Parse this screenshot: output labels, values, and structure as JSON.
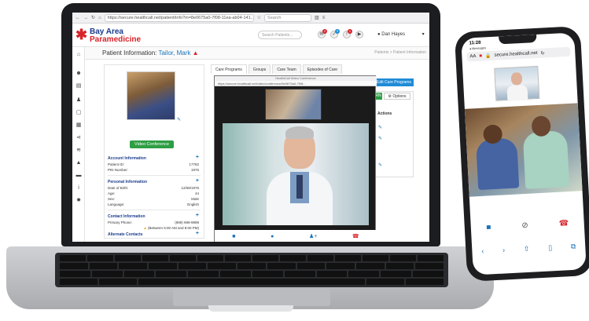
{
  "browser": {
    "url": "https://secure.healthcall.net/patient/info?m=8e0675a0-7f08-11ea-ab04-141...",
    "search_placeholder": "Search"
  },
  "app": {
    "logo_line1": "Bay Area",
    "logo_line2": "Paramedicine",
    "search_placeholder": "Search Patients...",
    "user_name": "Dan Hayes",
    "notification_badges": [
      "2",
      "3",
      "1"
    ]
  },
  "patient_bar": {
    "label": "Patient Information:",
    "name": "Tailor, Mark",
    "breadcrumb": "Patients > Patient Information"
  },
  "card": {
    "video_button": "Video Conference",
    "account_header": "Account Information",
    "account_rows": [
      {
        "label": "Patient ID:",
        "value": "17782"
      },
      {
        "label": "PIN Number:",
        "value": "1975"
      }
    ],
    "personal_header": "Personal Information",
    "personal_rows": [
      {
        "label": "Date of Birth:",
        "value": "12/08/1975"
      },
      {
        "label": "Age:",
        "value": "44"
      },
      {
        "label": "Sex:",
        "value": "Male"
      },
      {
        "label": "Language:",
        "value": "English"
      }
    ],
    "contact_header": "Contact Information",
    "contact_rows": [
      {
        "label": "Primary Phone:",
        "value": "(999) 999-9999"
      }
    ],
    "contact_note": "(Between 5:00 AM and 8:00 PM)",
    "alternate_header": "Alternate Contacts"
  },
  "tabs": [
    "Care Programs",
    "Groups",
    "Care Team",
    "Episodes of Care"
  ],
  "right_panel": {
    "edit_button": "Edit Care Programs",
    "rn_button": "RN",
    "options_button": "Options",
    "actions_header": "Actions"
  },
  "video_window": {
    "title": "HealthCall Video Conference",
    "url": "https://secure.healthcall.net/video/conference/8e0675a0-7f08..."
  },
  "phone": {
    "time": "11:28",
    "back_label": "Messages",
    "text_size": "AA",
    "domain": "secure.healthcall.net"
  },
  "colors": {
    "brand_blue": "#1a3b8c",
    "brand_red": "#d8232a",
    "accent_green": "#2e9e44",
    "link_blue": "#1a73b8"
  }
}
